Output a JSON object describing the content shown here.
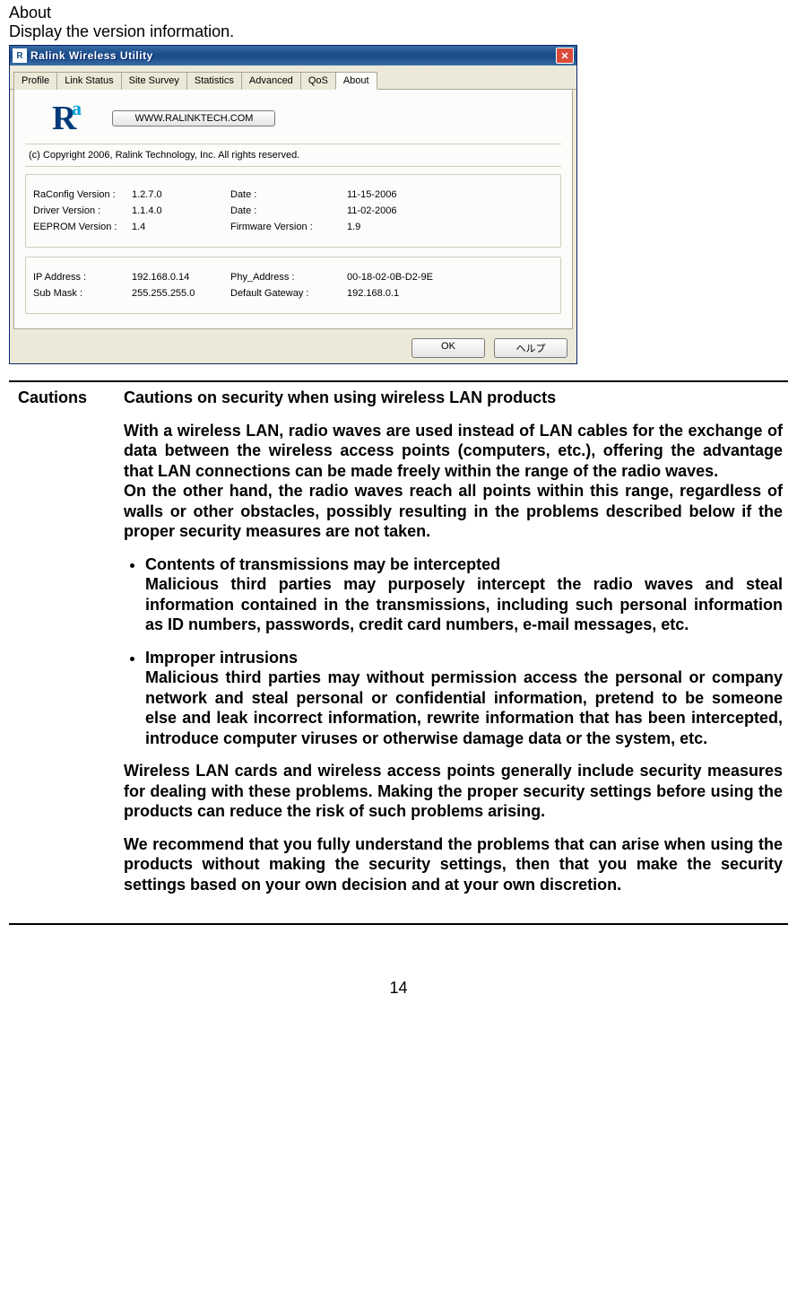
{
  "doc": {
    "heading": "About",
    "sub": "Display the version information.",
    "page_number": "14"
  },
  "window": {
    "title": "Ralink Wireless Utility",
    "tabs": [
      "Profile",
      "Link Status",
      "Site Survey",
      "Statistics",
      "Advanced",
      "QoS",
      "About"
    ],
    "active_tab": "About",
    "url_button": "WWW.RALINKTECH.COM",
    "copyright": "(c) Copyright 2006, Ralink Technology, Inc.  All rights reserved.",
    "group1": {
      "r1": {
        "l": "RaConfig Version :",
        "v": "1.2.7.0",
        "l2": "Date :",
        "v2": "11-15-2006"
      },
      "r2": {
        "l": "Driver Version :",
        "v": "1.1.4.0",
        "l2": "Date :",
        "v2": "11-02-2006"
      },
      "r3": {
        "l": "EEPROM Version :",
        "v": "1.4",
        "l2": "Firmware Version :",
        "v2": "1.9"
      }
    },
    "group2": {
      "r1": {
        "l": "IP Address :",
        "v": "192.168.0.14",
        "l2": "Phy_Address :",
        "v2": "00-18-02-0B-D2-9E"
      },
      "r2": {
        "l": "Sub Mask :",
        "v": "255.255.255.0",
        "l2": "Default Gateway :",
        "v2": "192.168.0.1"
      }
    },
    "buttons": {
      "ok": "OK",
      "help": "ヘルプ"
    }
  },
  "cautions": {
    "label": "Cautions",
    "title": "Cautions on security when using wireless LAN products",
    "p1": "With a wireless LAN, radio waves are used instead of LAN cables for the exchange of data between the wireless access points (computers, etc.), offering the advantage that LAN connections can be made freely within the range of the radio waves.",
    "p1b": "On the other hand, the radio waves reach all points within this range, regardless of walls or other obstacles, possibly resulting in the problems described below if the proper security measures are not taken.",
    "b1t": "Contents of transmissions may be intercepted",
    "b1": "Malicious third parties may purposely intercept the radio waves and steal information contained in the transmissions, including such personal information as ID numbers, passwords, credit card numbers, e-mail messages, etc.",
    "b2t": "Improper intrusions",
    "b2": "Malicious third parties may without permission access the personal or company network and steal personal or confidential information, pretend to be someone else and leak incorrect information, rewrite information that has been intercepted, introduce computer viruses or otherwise damage data or the system, etc.",
    "p2": "Wireless LAN cards and wireless access points generally include security measures for dealing with these problems. Making the proper security settings before using the products can reduce the risk of such problems arising.",
    "p3": "We recommend that you fully understand the problems that can arise when using the products without making the security settings, then that you make the security settings based on your own decision and at your own discretion."
  }
}
